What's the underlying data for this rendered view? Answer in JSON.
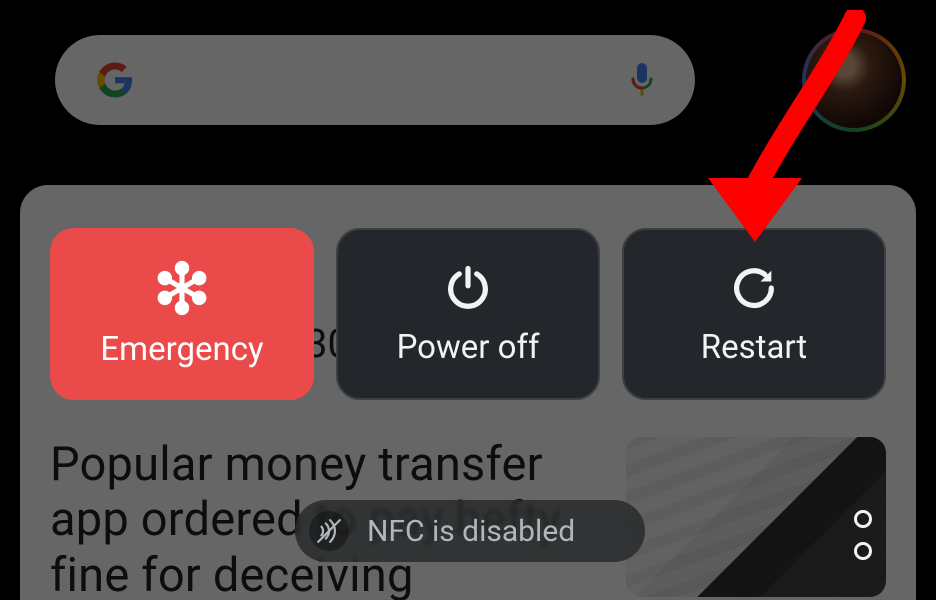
{
  "colors": {
    "emergency": "#ea4a4a",
    "tile_bg": "#23272b",
    "tile_border": "#3c4043",
    "arrow": "#ff0000"
  },
  "background_feed": {
    "home_percent": "30%",
    "headline": "Popular money transfer app ordered to pay hefty fine for deceiving"
  },
  "power_menu": {
    "emergency": {
      "label": "Emergency",
      "icon": "medical-asterisk-icon"
    },
    "power_off": {
      "label": "Power off",
      "icon": "power-icon"
    },
    "restart": {
      "label": "Restart",
      "icon": "restart-icon"
    }
  },
  "toast": {
    "icon": "nfc-off-icon",
    "text": "NFC is disabled"
  },
  "annotation_arrow": {
    "target": "restart-button",
    "color": "#ff0000"
  }
}
